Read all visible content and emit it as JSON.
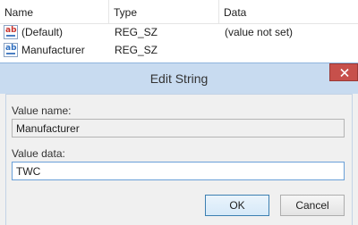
{
  "registry": {
    "headers": {
      "name": "Name",
      "type": "Type",
      "data": "Data"
    },
    "rows": [
      {
        "icon": "string-value-icon",
        "icon_text": "ab",
        "name": "(Default)",
        "type": "REG_SZ",
        "data": "(value not set)"
      },
      {
        "icon": "string-value-icon",
        "icon_text": "ab",
        "name": "Manufacturer",
        "type": "REG_SZ",
        "data": ""
      }
    ]
  },
  "dialog": {
    "title": "Edit String",
    "value_name_label": "Value name:",
    "value_name": "Manufacturer",
    "value_data_label": "Value data:",
    "value_data": "TWC",
    "ok_label": "OK",
    "cancel_label": "Cancel",
    "colors": {
      "titlebar": "#c8dbf0",
      "close": "#c7504b"
    }
  }
}
